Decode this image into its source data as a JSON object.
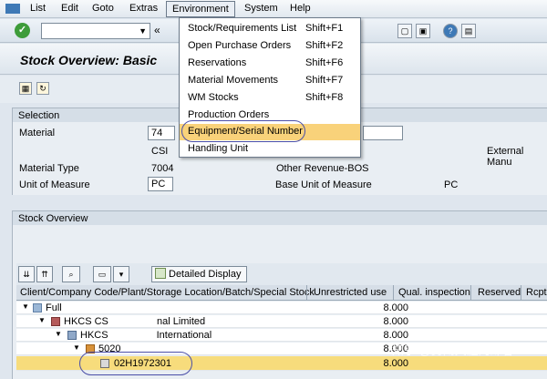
{
  "menubar": {
    "items": [
      "List",
      "Edit",
      "Goto",
      "Extras",
      "Environment",
      "System",
      "Help"
    ]
  },
  "title": "Stock Overview: Basic",
  "selection": {
    "group_title": "Selection",
    "material_label": "Material",
    "material_value": "74",
    "short_text": "CSI",
    "external_label": "External Manu",
    "material_type_label": "Material Type",
    "material_type_value": "7004",
    "other_label": "Other Revenue-BOS",
    "uom_label": "Unit of Measure",
    "uom_value": "PC",
    "base_uom_label": "Base Unit of Measure",
    "base_uom_value": "PC"
  },
  "overview": {
    "group_title": "Stock Overview",
    "detail_button": "Detailed Display",
    "headers": [
      "Client/Company Code/Plant/Storage Location/Batch/Special Stock",
      "Unrestricted use",
      "Qual. inspection",
      "Reserved",
      "Rcpt"
    ],
    "rows": [
      {
        "name": "Full",
        "qty": "8.000"
      },
      {
        "name_a": "HKCS CS ",
        "name_b": "nal Limited",
        "qty": "8.000"
      },
      {
        "name_a": "HKCS ",
        "name_b": "International",
        "qty": "8.000"
      },
      {
        "name_a": "5020 ",
        "qty": "8.000"
      },
      {
        "name": "02H1972301",
        "qty": "8.000"
      }
    ]
  },
  "environment_menu": {
    "items": [
      {
        "label": "Stock/Requirements List",
        "key": "Shift+F1"
      },
      {
        "label": "Open Purchase Orders",
        "key": "Shift+F2"
      },
      {
        "label": "Reservations",
        "key": "Shift+F6"
      },
      {
        "label": "Material Movements",
        "key": "Shift+F7"
      },
      {
        "label": "WM Stocks",
        "key": "Shift+F8"
      },
      {
        "label": "Production Orders",
        "key": ""
      },
      {
        "label": "Equipment/Serial Number",
        "key": ""
      },
      {
        "label": "Handling Unit",
        "key": ""
      }
    ]
  },
  "watermark": "知乎 @勇闯天涯的虾客"
}
